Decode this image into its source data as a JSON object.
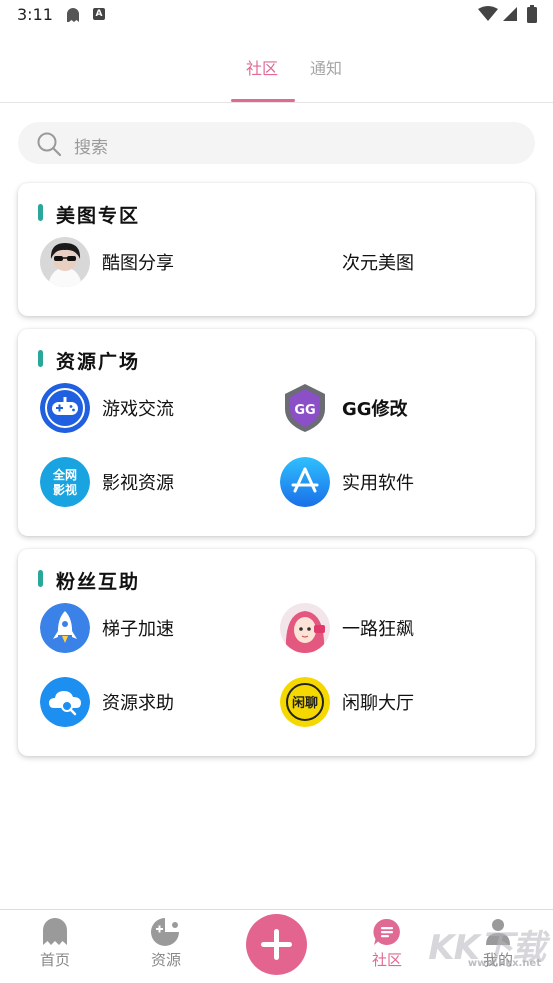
{
  "status_bar": {
    "time": "3:11",
    "icons": [
      "ghost-icon",
      "a-badge-icon",
      "wifi-icon",
      "signal-icon",
      "battery-icon"
    ]
  },
  "tabs": [
    {
      "label": "社区",
      "active": true
    },
    {
      "label": "通知",
      "active": false
    }
  ],
  "search": {
    "placeholder": "搜索"
  },
  "sections": [
    {
      "title": "美图专区",
      "items": [
        {
          "label": "酷图分享",
          "icon": "avatar-photo"
        },
        {
          "label": "次元美图",
          "icon": ""
        }
      ]
    },
    {
      "title": "资源广场",
      "items": [
        {
          "label": "游戏交流",
          "icon": "gamepad-icon"
        },
        {
          "label": "GG修改",
          "icon": "gg-shield-icon"
        },
        {
          "label": "影视资源",
          "icon": "quanwang-yingshi-icon"
        },
        {
          "label": "实用软件",
          "icon": "appstore-icon"
        }
      ]
    },
    {
      "title": "粉丝互助",
      "items": [
        {
          "label": "梯子加速",
          "icon": "rocket-icon"
        },
        {
          "label": "一路狂飙",
          "icon": "anime-avatar-icon"
        },
        {
          "label": "资源求助",
          "icon": "cloud-search-icon"
        },
        {
          "label": "闲聊大厅",
          "icon": "chat-badge-icon"
        }
      ]
    }
  ],
  "bottom_nav": [
    {
      "label": "首页",
      "icon": "ghost-icon",
      "active": false
    },
    {
      "label": "资源",
      "icon": "pacman-icon",
      "active": false
    },
    {
      "label": "",
      "icon": "plus-icon",
      "active": false
    },
    {
      "label": "社区",
      "icon": "chat-icon",
      "active": true
    },
    {
      "label": "我的",
      "icon": "user-icon",
      "active": false
    }
  ],
  "badges": {
    "avatar_small": "全网",
    "avatar_small2": "影视",
    "gg_text": "GG",
    "chat_badge": "闲聊"
  },
  "watermark": {
    "text": "KK下载",
    "url": "www.kkx.net"
  },
  "colors": {
    "accent": "#e06a94",
    "section_bar": "#2aa79b",
    "fab": "#e3658f"
  }
}
